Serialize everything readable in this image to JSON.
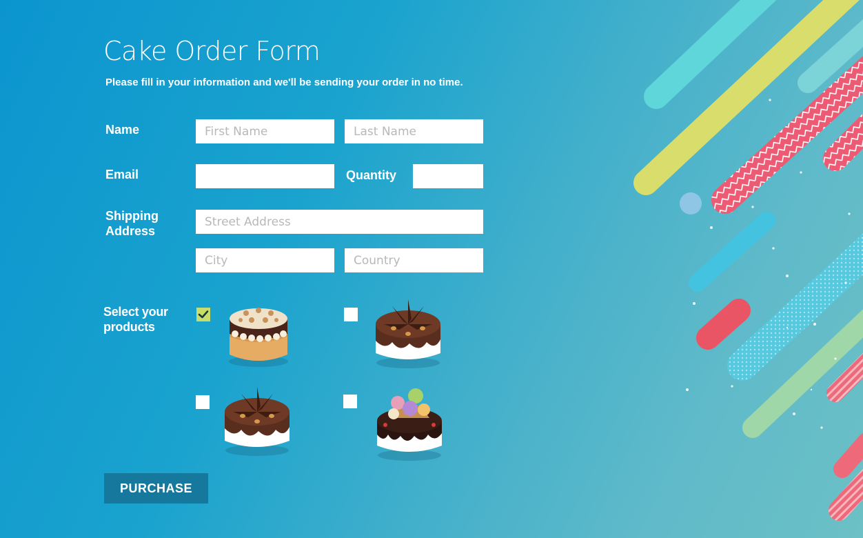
{
  "form": {
    "title": "Cake Order Form",
    "subtitle": "Please fill in your information and we'll be sending your order in no time.",
    "name": {
      "label": "Name",
      "first_placeholder": "First Name",
      "last_placeholder": "Last Name"
    },
    "email": {
      "label": "Email",
      "value": ""
    },
    "quantity": {
      "label": "Quantity",
      "value": ""
    },
    "shipping": {
      "label_line1": "Shipping",
      "label_line2": "Address",
      "street_placeholder": "Street Address",
      "city_placeholder": "City",
      "country_placeholder": "Country"
    },
    "products": {
      "label_line1": "Select your",
      "label_line2": "products",
      "items": [
        {
          "icon": "caramel-cake-icon",
          "checked": true
        },
        {
          "icon": "chocolate-cake-icon",
          "checked": false
        },
        {
          "icon": "chocolate-cake-icon",
          "checked": false
        },
        {
          "icon": "ice-cream-cake-icon",
          "checked": false
        }
      ]
    },
    "purchase_label": "PURCHASE"
  },
  "colors": {
    "background_start": "#0b95cf",
    "background_end": "#6cc0c6",
    "button": "#16789d",
    "checkbox_checked": "#c9de6a"
  }
}
